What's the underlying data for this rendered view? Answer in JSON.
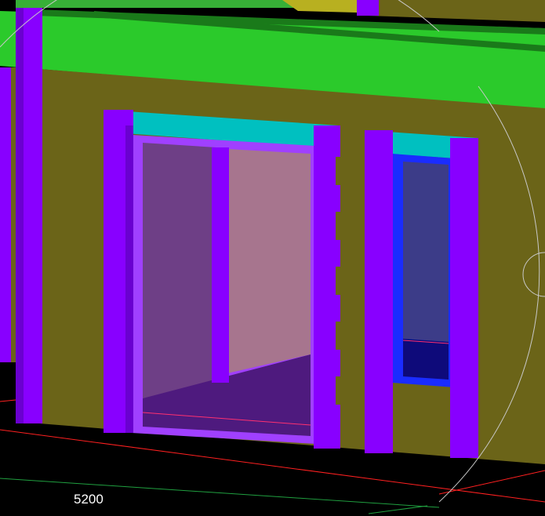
{
  "viewport": {
    "name": "3d-model-view",
    "dimension_label": "5200"
  },
  "colors": {
    "background": "#000000",
    "wall": "#6b6418",
    "roof_green": "#2bca2b",
    "roof_dark_green": "#1a7a1a",
    "roof_top_green": "#37b037",
    "yellow_panel": "#b8b020",
    "column_purple": "#8800ff",
    "column_purple_dark": "#6a00d0",
    "lintel_cyan": "#00c0c0",
    "door_frame": "#a040ff",
    "door_glass_left": "#6e3f86",
    "door_glass_right": "#a7758e",
    "door_floor": "#4e1a7e",
    "window_frame": "#1a2cff",
    "window_glass": "#3c3c88",
    "window_bottom": "#0e0a7a",
    "grid_red": "#ff2020",
    "grid_green": "#20a040",
    "nav_circle": "#c8c8c8",
    "dimension_text": "#ffffff"
  }
}
